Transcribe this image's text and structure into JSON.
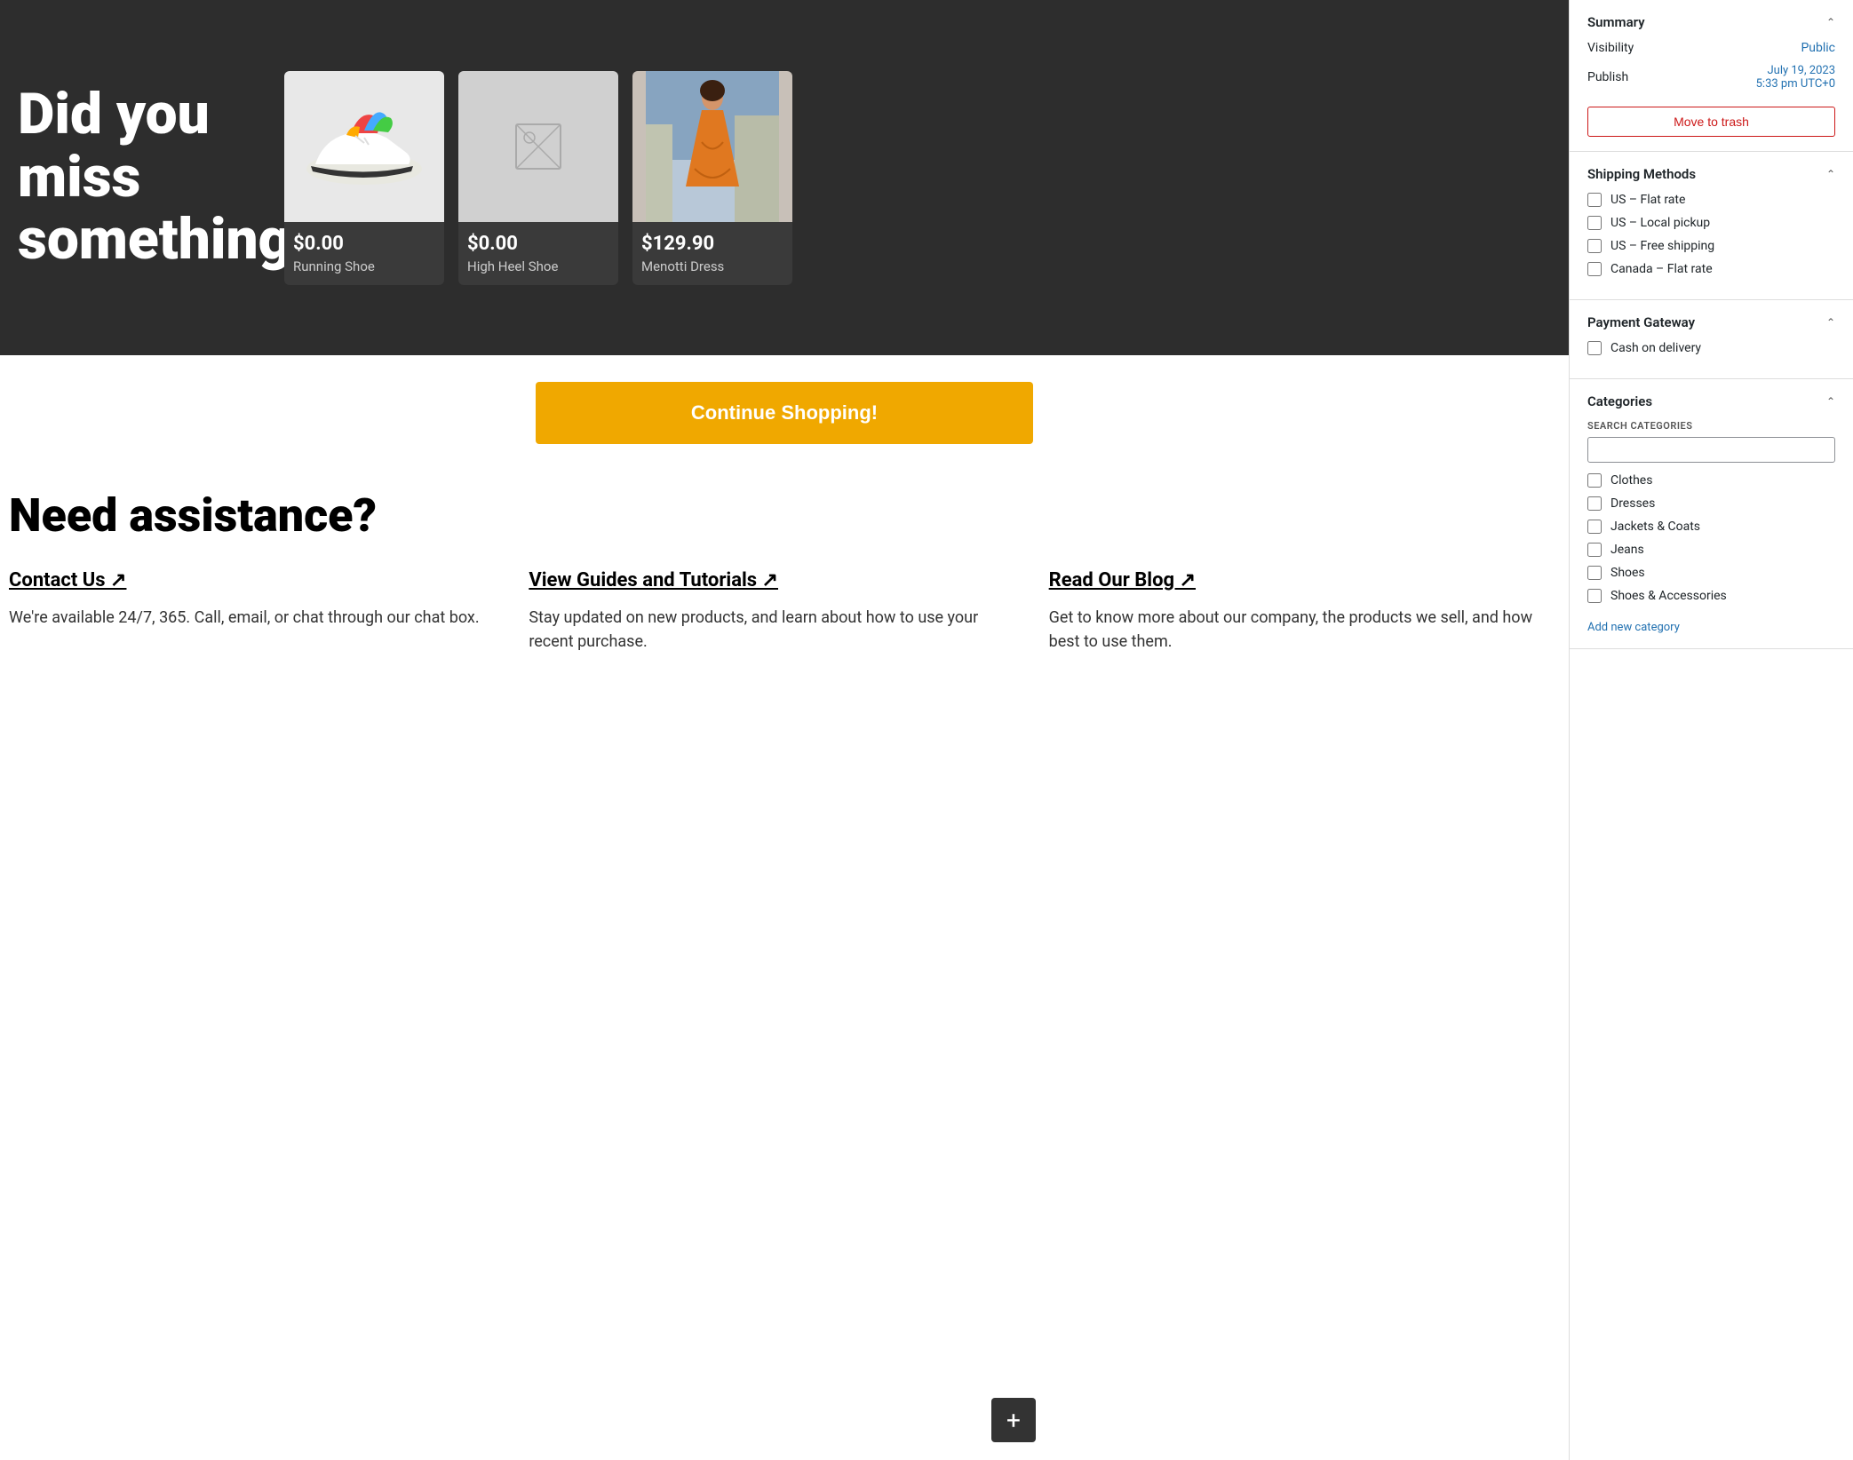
{
  "hero": {
    "headline": "Did you miss something?",
    "products": [
      {
        "price": "$0.00",
        "name": "Running Shoe",
        "type": "shoe"
      },
      {
        "price": "$0.00",
        "name": "High Heel Shoe",
        "type": "placeholder"
      },
      {
        "price": "$129.90",
        "name": "Menotti Dress",
        "type": "dress"
      }
    ]
  },
  "continue_btn": "Continue Shopping!",
  "assistance": {
    "title": "Need assistance?",
    "items": [
      {
        "link": "Contact Us ↗",
        "desc": "We're available 24/7, 365. Call, email, or chat through our chat box."
      },
      {
        "link": "View Guides and Tutorials ↗",
        "desc": "Stay updated on new products, and learn about how to use your recent purchase."
      },
      {
        "link": "Read Our Blog ↗",
        "desc": "Get to know more about our company, the products we sell, and how best to use them."
      }
    ]
  },
  "sidebar": {
    "summary": {
      "title": "Summary",
      "visibility_label": "Visibility",
      "visibility_value": "Public",
      "publish_label": "Publish",
      "publish_value_line1": "July 19, 2023",
      "publish_value_line2": "5:33 pm UTC+0",
      "trash_btn": "Move to trash"
    },
    "shipping": {
      "title": "Shipping Methods",
      "methods": [
        {
          "label": "US – Flat rate",
          "checked": false
        },
        {
          "label": "US – Local pickup",
          "checked": false
        },
        {
          "label": "US – Free shipping",
          "checked": false
        },
        {
          "label": "Canada – Flat rate",
          "checked": false
        }
      ]
    },
    "payment": {
      "title": "Payment Gateway",
      "methods": [
        {
          "label": "Cash on delivery",
          "checked": false
        }
      ]
    },
    "categories": {
      "title": "Categories",
      "search_label": "SEARCH CATEGORIES",
      "search_placeholder": "",
      "items": [
        {
          "label": "Clothes",
          "checked": false
        },
        {
          "label": "Dresses",
          "checked": false
        },
        {
          "label": "Jackets & Coats",
          "checked": false
        },
        {
          "label": "Jeans",
          "checked": false
        },
        {
          "label": "Shoes",
          "checked": false
        },
        {
          "label": "Shoes & Accessories",
          "checked": false
        }
      ],
      "add_link": "Add new category"
    }
  },
  "float_btn": "+"
}
